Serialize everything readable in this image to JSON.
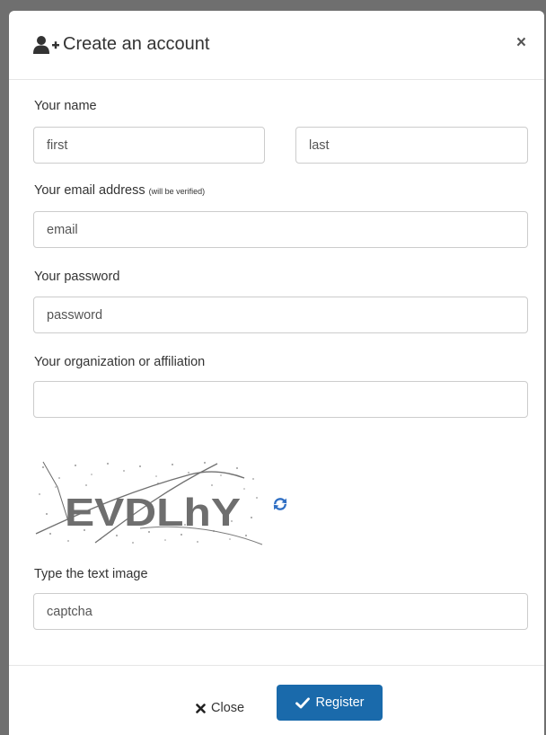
{
  "dialog": {
    "title": "Create an account",
    "close_glyph": "×"
  },
  "form": {
    "name_label": "Your name",
    "first_placeholder": "first",
    "last_placeholder": "last",
    "email_label": "Your email address",
    "email_note": "(will be verified)",
    "email_placeholder": "email",
    "password_label": "Your password",
    "password_placeholder": "password",
    "organization_label": "Your organization or affiliation",
    "organization_value": "",
    "captcha_text": "EVDLhY",
    "captcha_label": "Type the text image",
    "captcha_placeholder": "captcha"
  },
  "footer": {
    "close_label": "Close",
    "register_label": "Register"
  },
  "icons": {
    "header": "user-plus-icon",
    "close": "close-icon",
    "refresh": "refresh-icon",
    "footer_close": "times-icon",
    "register": "check-icon"
  },
  "colors": {
    "primary": "#1a6aab",
    "refresh": "#2f6fc4",
    "backdrop": "#6f6f6f"
  }
}
